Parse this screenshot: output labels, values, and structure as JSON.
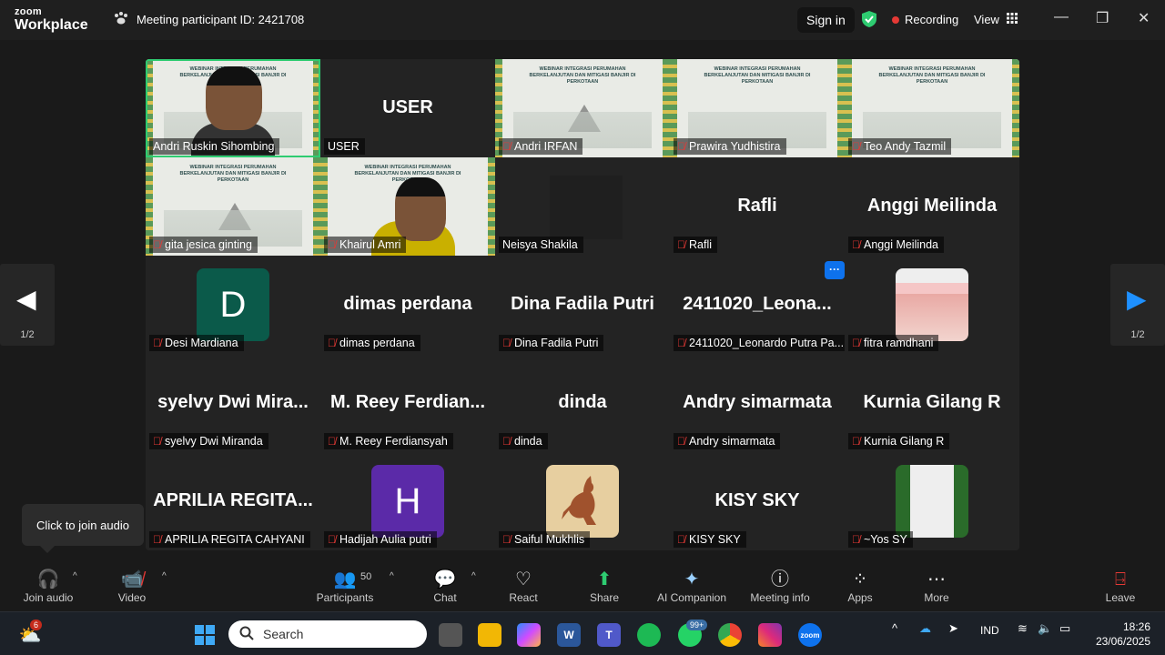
{
  "app": {
    "logo_line1": "zoom",
    "logo_line2": "Workplace"
  },
  "meeting": {
    "participant_id_label": "Meeting participant ID: 2421708"
  },
  "header": {
    "sign_in": "Sign in",
    "recording": "Recording",
    "view": "View"
  },
  "slide": {
    "title": "WEBINAR INTEGRASI PERUMAHAN BERKELANJUTAN DAN MITIGASI BANJIR DI PERKOTAAN"
  },
  "tiles": [
    {
      "name": "Andri Ruskin Sihombing",
      "big": "",
      "muted": false
    },
    {
      "name": "USER",
      "big": "USER",
      "muted": false
    },
    {
      "name": "Andri IRFAN",
      "big": "",
      "muted": true
    },
    {
      "name": "Prawira Yudhistira",
      "big": "",
      "muted": true
    },
    {
      "name": "Teo Andy Tazmil",
      "big": "",
      "muted": true
    },
    {
      "name": "gita jesica ginting",
      "big": "",
      "muted": true
    },
    {
      "name": "Khairul Amri",
      "big": "",
      "muted": true
    },
    {
      "name": "Neisya Shakila",
      "big": "",
      "muted": false
    },
    {
      "name": "Rafli",
      "big": "Rafli",
      "muted": true
    },
    {
      "name": "Anggi Meilinda",
      "big": "Anggi Meilinda",
      "muted": true
    },
    {
      "name": "Desi Mardiana",
      "big": "D",
      "muted": true
    },
    {
      "name": "dimas perdana",
      "big": "dimas perdana",
      "muted": true
    },
    {
      "name": "Dina Fadila Putri",
      "big": "Dina Fadila Putri",
      "muted": true
    },
    {
      "name": "2411020_Leonardo Putra Pa...",
      "big": "2411020_Leona...",
      "muted": true
    },
    {
      "name": "fitra ramdhani",
      "big": "",
      "muted": true
    },
    {
      "name": "syelvy Dwi Miranda",
      "big": "syelvy Dwi Mira...",
      "muted": true
    },
    {
      "name": "M. Reey Ferdiansyah",
      "big": "M. Reey Ferdian...",
      "muted": true
    },
    {
      "name": "dinda",
      "big": "dinda",
      "muted": true
    },
    {
      "name": "Andry simarmata",
      "big": "Andry simarmata",
      "muted": true
    },
    {
      "name": "Kurnia Gilang R",
      "big": "Kurnia Gilang R",
      "muted": true
    },
    {
      "name": "APRILIA REGITA CAHYANI",
      "big": "APRILIA REGITA...",
      "muted": true
    },
    {
      "name": "Hadijah Aulia putri",
      "big": "H",
      "muted": true
    },
    {
      "name": "Saiful Mukhlis",
      "big": "",
      "muted": true
    },
    {
      "name": "KISY SKY",
      "big": "KISY SKY",
      "muted": true
    },
    {
      "name": "~Yos SY",
      "big": "",
      "muted": true
    }
  ],
  "pagination": {
    "left": "1/2",
    "right": "1/2"
  },
  "more_badge": "···",
  "tooltip": "Click to join audio",
  "toolbar": {
    "join_audio": "Join audio",
    "video": "Video",
    "participants": "Participants",
    "participants_count": "50",
    "chat": "Chat",
    "react": "React",
    "share": "Share",
    "ai_companion": "AI Companion",
    "meeting_info": "Meeting info",
    "apps": "Apps",
    "more": "More",
    "leave": "Leave"
  },
  "taskbar": {
    "search_placeholder": "Search",
    "weather_badge": "6",
    "whatsapp_badge": "99+",
    "lang": "IND",
    "time": "18:26",
    "date": "23/06/2025"
  },
  "colors": {
    "accent": "#0e72ed",
    "selected": "#2ecc71",
    "muted": "#e53935",
    "share": "#2ecc71"
  }
}
